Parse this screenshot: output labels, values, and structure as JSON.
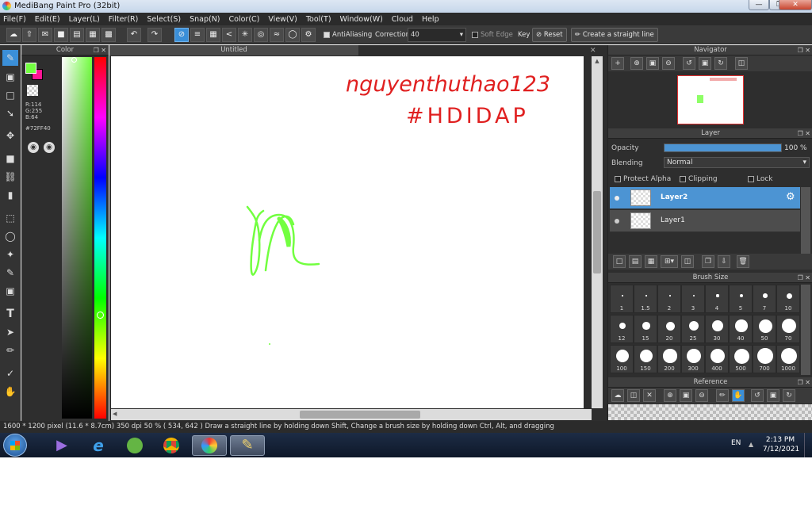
{
  "window": {
    "title": "MediBang Paint Pro (32bit)"
  },
  "menu": [
    "File(F)",
    "Edit(E)",
    "Layer(L)",
    "Filter(R)",
    "Select(S)",
    "Snap(N)",
    "Color(C)",
    "View(V)",
    "Tool(T)",
    "Window(W)",
    "Cloud",
    "Help"
  ],
  "toolbar": {
    "antialiasing_label": "AntiAliasing",
    "antialiasing_checked": true,
    "correction_label": "Correction",
    "correction_value": "40",
    "soft_edge_label": "Soft Edge",
    "soft_edge_checked": false,
    "key_label": "Key",
    "reset_label": "Reset",
    "straight_line_label": "Create a straight line"
  },
  "color_panel": {
    "title": "Color",
    "r_label": "R:114",
    "g_label": "G:255",
    "b_label": "B:64",
    "hex_label": "#72FF40",
    "main_color": "#72FF40",
    "sub_color": "#FF1493"
  },
  "canvas": {
    "tab_title": "Untitled",
    "handwriting_line1": "nguyenthuthao123",
    "handwriting_line2": "#HDIDAP",
    "ink_color": "#E02020",
    "stroke_color": "#72FF40"
  },
  "navigator": {
    "title": "Navigator"
  },
  "layer_panel": {
    "title": "Layer",
    "opacity_label": "Opacity",
    "opacity_value": "100 %",
    "opacity_fraction": 1.0,
    "blending_label": "Blending",
    "blending_value": "Normal",
    "protect_alpha_label": "Protect Alpha",
    "clipping_label": "Clipping",
    "lock_label": "Lock",
    "layers": [
      {
        "name": "Layer2",
        "selected": true
      },
      {
        "name": "Layer1",
        "selected": false
      }
    ]
  },
  "brush_size": {
    "title": "Brush Size",
    "sizes": [
      "1",
      "1.5",
      "2",
      "3",
      "4",
      "5",
      "7",
      "10",
      "12",
      "15",
      "20",
      "25",
      "30",
      "40",
      "50",
      "70",
      "100",
      "150",
      "200",
      "300",
      "400",
      "500",
      "700",
      "1000"
    ]
  },
  "reference": {
    "title": "Reference"
  },
  "status": {
    "text": "1600 * 1200 pixel   (11.6 * 8.7cm)   350 dpi   50 %   ( 534, 642 )   Draw a straight line by holding down Shift, Change a brush size by holding down Ctrl, Alt, and dragging"
  },
  "taskbar": {
    "lang": "EN",
    "time": "2:13 PM",
    "date": "7/12/2021"
  }
}
